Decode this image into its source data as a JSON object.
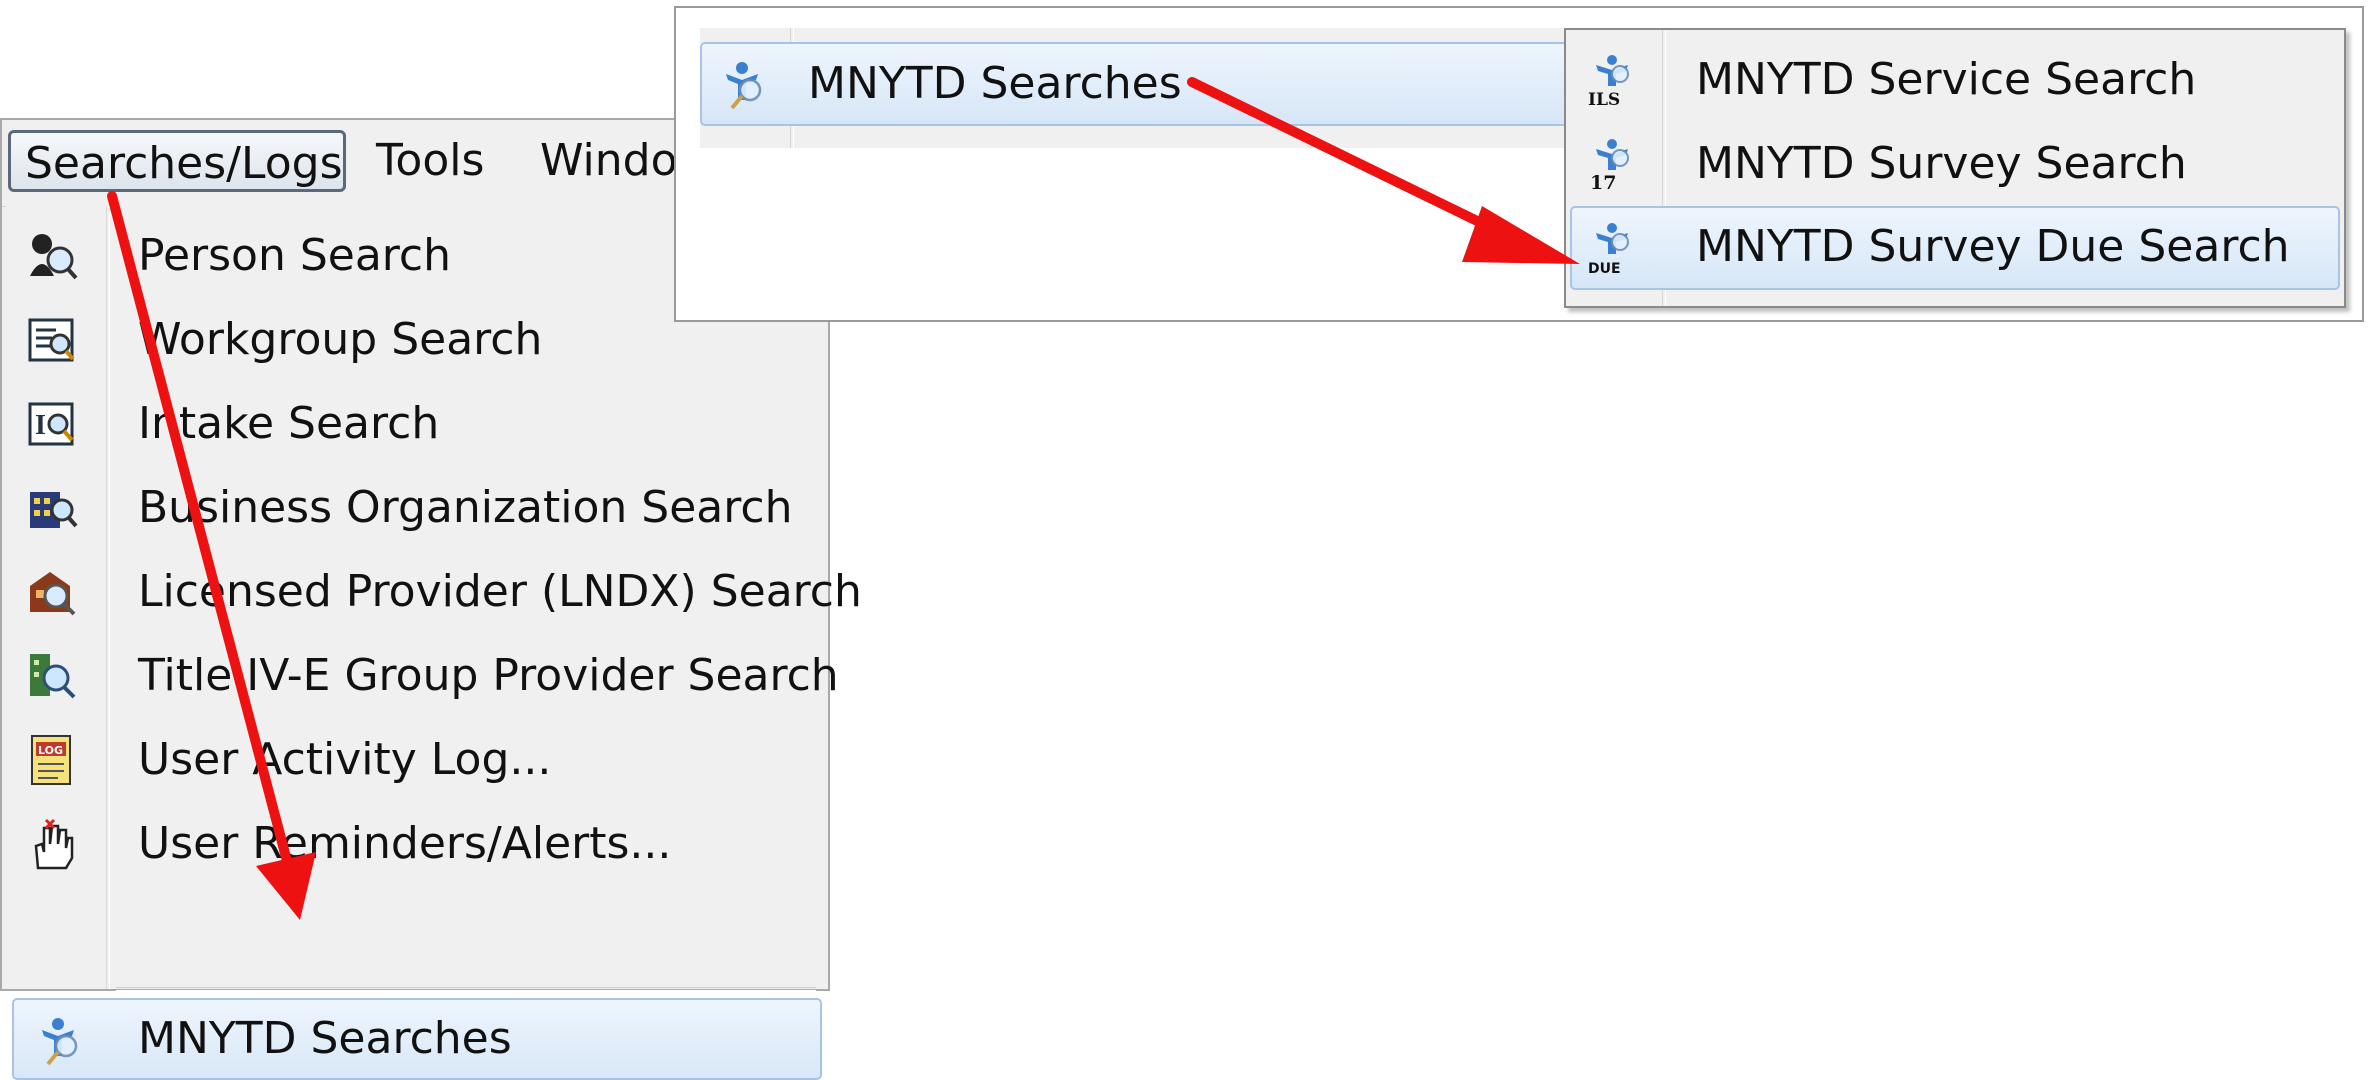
{
  "menubar": {
    "items": [
      {
        "label": "Searches/Logs"
      },
      {
        "label": "Tools"
      },
      {
        "label": "Windo"
      }
    ]
  },
  "dropdown": {
    "items": [
      {
        "label": "Person Search",
        "icon": "person-search-icon"
      },
      {
        "label": "Workgroup Search",
        "icon": "workgroup-search-icon"
      },
      {
        "label": "Intake Search",
        "icon": "intake-search-icon"
      },
      {
        "label": "Business Organization Search",
        "icon": "business-organization-search-icon"
      },
      {
        "label": "Licensed Provider (LNDX) Search",
        "icon": "licensed-provider-search-icon"
      },
      {
        "label": "Title IV-E Group Provider Search",
        "icon": "title-ive-provider-search-icon"
      },
      {
        "label": "User Activity Log...",
        "icon": "log-icon"
      },
      {
        "label": "User Reminders/Alerts...",
        "icon": "reminder-hand-icon"
      }
    ],
    "highlighted": {
      "label": "MNYTD Searches",
      "icon": "mnytd-icon"
    }
  },
  "parent_menu": {
    "label": "MNYTD Searches",
    "icon": "mnytd-icon"
  },
  "submenu": {
    "items": [
      {
        "label": "MNYTD Service Search",
        "icon": "mnytd-ils-icon",
        "icon_text": "ILS"
      },
      {
        "label": "MNYTD Survey Search",
        "icon": "mnytd-17-icon",
        "icon_text": "17"
      },
      {
        "label": "MNYTD Survey Due Search",
        "icon": "mnytd-due-icon",
        "icon_text": "DUE"
      }
    ]
  },
  "colors": {
    "arrow": "#ee1111",
    "highlight_border": "#a7c4e6",
    "menu_bg": "#f0f0f0"
  }
}
